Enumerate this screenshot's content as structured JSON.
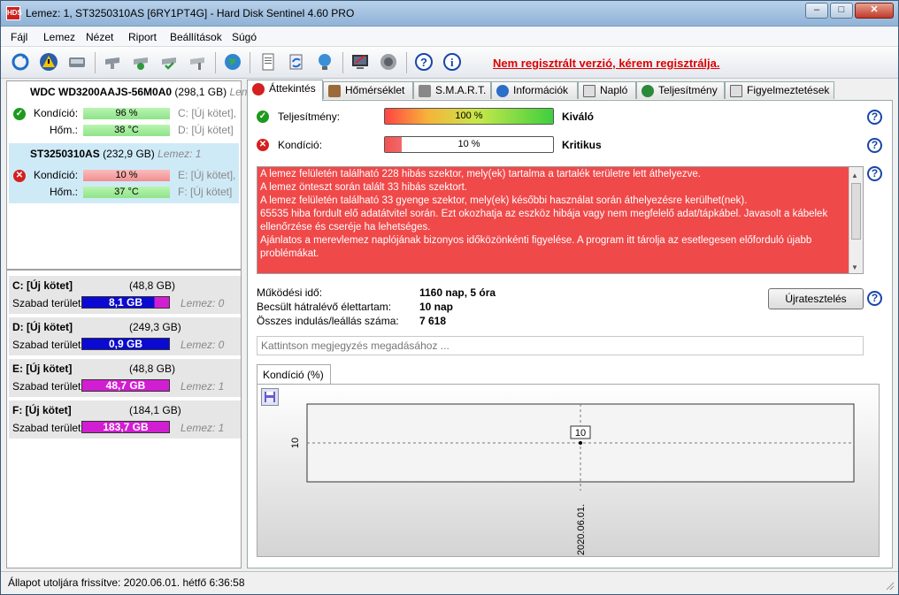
{
  "window": {
    "title": "Lemez: 1, ST3250310AS [6RY1PT4G]  -  Hard Disk Sentinel 4.60 PRO",
    "app_icon_text": "HDS"
  },
  "menu": [
    "Fájl",
    "Lemez",
    "Nézet",
    "Riport",
    "Beállítások",
    "Súgó"
  ],
  "toolbar": {
    "icons": [
      "refresh-icon",
      "alert-icon",
      "disk-icon",
      "disk-gray-icon",
      "disk-check-icon",
      "disk-verify-icon",
      "disk-tool-icon",
      "globe-icon",
      "document-icon",
      "sync-icon",
      "network-icon",
      "report-icon",
      "speaker-icon",
      "help-icon",
      "info-icon"
    ],
    "registration_notice": "Nem regisztrált verzió, kérem regisztrálja."
  },
  "disks": [
    {
      "name": "WDC WD3200AAJS-56M0A0",
      "size": "(298,1 GB)",
      "lemez": "Len",
      "condition_label": "Kondíció:",
      "condition_value": "96 %",
      "temp_label": "Hőm.:",
      "temp_value": "38 °C",
      "vol1": "C: [Új kötet],",
      "vol2": "D: [Új kötet]"
    },
    {
      "name": "ST3250310AS",
      "size": "(232,9 GB)",
      "lemez": "Lemez: 1",
      "condition_label": "Kondíció:",
      "condition_value": "10 %",
      "temp_label": "Hőm.:",
      "temp_value": "37 °C",
      "vol1": "E: [Új kötet],",
      "vol2": "F: [Új kötet]"
    }
  ],
  "volumes": [
    {
      "name": "C: [Új kötet]",
      "size": "(48,8 GB)",
      "free_label": "Szabad terület",
      "free": "8,1 GB",
      "lemez": "Lemez: 0",
      "fill_color": "#0a0ad2",
      "rest_color": "#d21ed2",
      "fill_pct": 83
    },
    {
      "name": "D: [Új kötet]",
      "size": "(249,3 GB)",
      "free_label": "Szabad terület",
      "free": "0,9 GB",
      "lemez": "Lemez: 0",
      "fill_color": "#0a0ad2",
      "rest_color": "#d21ed2",
      "fill_pct": 100
    },
    {
      "name": "E: [Új kötet]",
      "size": "(48,8 GB)",
      "free_label": "Szabad terület",
      "free": "48,7 GB",
      "lemez": "Lemez: 1",
      "fill_color": "#d21ed2",
      "rest_color": "#d21ed2",
      "fill_pct": 100
    },
    {
      "name": "F: [Új kötet]",
      "size": "(184,1 GB)",
      "free_label": "Szabad terület",
      "free": "183,7 GB",
      "lemez": "Lemez: 1",
      "fill_color": "#d21ed2",
      "rest_color": "#d21ed2",
      "fill_pct": 100
    }
  ],
  "tabs": [
    "Áttekintés",
    "Hőmérséklet",
    "S.M.A.R.T.",
    "Információk",
    "Napló",
    "Teljesítmény",
    "Figyelmeztetések"
  ],
  "overview": {
    "performance_label": "Teljesítmény:",
    "performance_value": "100 %",
    "performance_pct": 100,
    "performance_rating": "Kiváló",
    "condition_label": "Kondíció:",
    "condition_value": "10 %",
    "condition_pct": 10,
    "condition_rating": "Kritikus",
    "messages": [
      "A lemez felületén található 228 hibás szektor, mely(ek) tartalma a tartalék területre lett áthelyezve.",
      "A lemez önteszt során talált 33 hibás szektort.",
      "A lemez felületén található 33 gyenge szektor, mely(ek) későbbi használat során áthelyezésre kerülhet(nek).",
      "65535 hiba fordult elő adatátvitel során. Ezt okozhatja az eszköz hibája vagy nem megfelelő adat/tápkábel. Javasolt a kábelek ellenőrzése és cseréje ha lehetséges.",
      "Ajánlatos a merevlemez naplójának bizonyos időközönkénti figyelése. A program itt tárolja az esetlegesen előforduló újabb problémákat."
    ],
    "uptime_label": "Működési idő:",
    "uptime_value": "1160 nap, 5 óra",
    "lifetime_label": "Becsült hátralévő élettartam:",
    "lifetime_value": "10 nap",
    "starts_label": "Összes indulás/leállás száma:",
    "starts_value": "7 618",
    "retest_label": "Újratesztelés",
    "comment_placeholder": "Kattintson megjegyzés megadásához ...",
    "chart_tab": "Kondíció  (%)"
  },
  "chart_data": {
    "type": "line",
    "title": "Kondíció  (%)",
    "x": [
      "2020.06.01."
    ],
    "series": [
      {
        "values": [
          10
        ]
      }
    ],
    "ytick_labels": [
      "10"
    ],
    "data_labels": [
      "10"
    ]
  },
  "status": {
    "text": "Állapot utoljára frissítve: 2020.06.01. hétfő 6:36:58"
  },
  "colors": {
    "alert_red": "#f0494a",
    "registration_red": "#dd0000",
    "ok_green": "#1e9a1e",
    "bad_red": "#d42020"
  }
}
